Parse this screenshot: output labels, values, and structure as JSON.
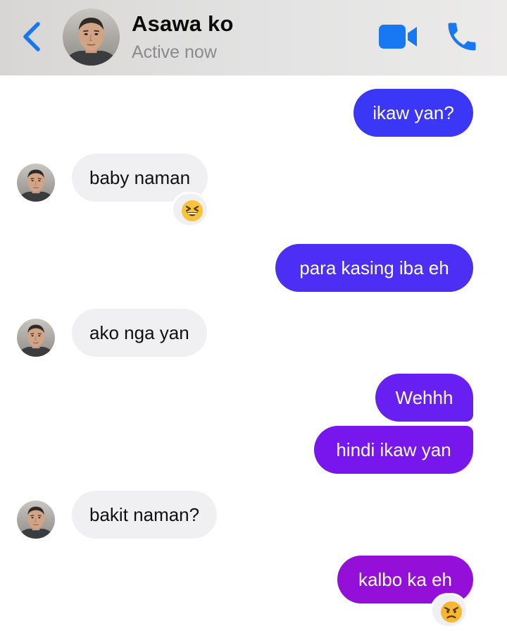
{
  "header": {
    "contact_name": "Asawa ko",
    "status": "Active now",
    "back_icon": "chevron-left-icon",
    "video_icon": "video-camera-icon",
    "call_icon": "phone-icon",
    "accent_color": "#1877f2"
  },
  "messages": [
    {
      "direction": "outgoing",
      "text": "ikaw yan?"
    },
    {
      "direction": "incoming",
      "text": "baby naman",
      "reaction": "grinning-squinting-face"
    },
    {
      "direction": "outgoing",
      "text": "para kasing iba eh"
    },
    {
      "direction": "incoming",
      "text": "ako nga yan"
    },
    {
      "direction": "outgoing",
      "text": "Wehhh"
    },
    {
      "direction": "outgoing",
      "text": "hindi ikaw yan"
    },
    {
      "direction": "incoming",
      "text": "bakit naman?"
    },
    {
      "direction": "outgoing",
      "text": "kalbo ka eh",
      "reaction": "angry-face"
    }
  ],
  "colors": {
    "incoming_bubble": "#f0f0f2",
    "outgoing_gradient_top": "#3a36f8",
    "outgoing_gradient_bottom": "#9d0bd8"
  }
}
